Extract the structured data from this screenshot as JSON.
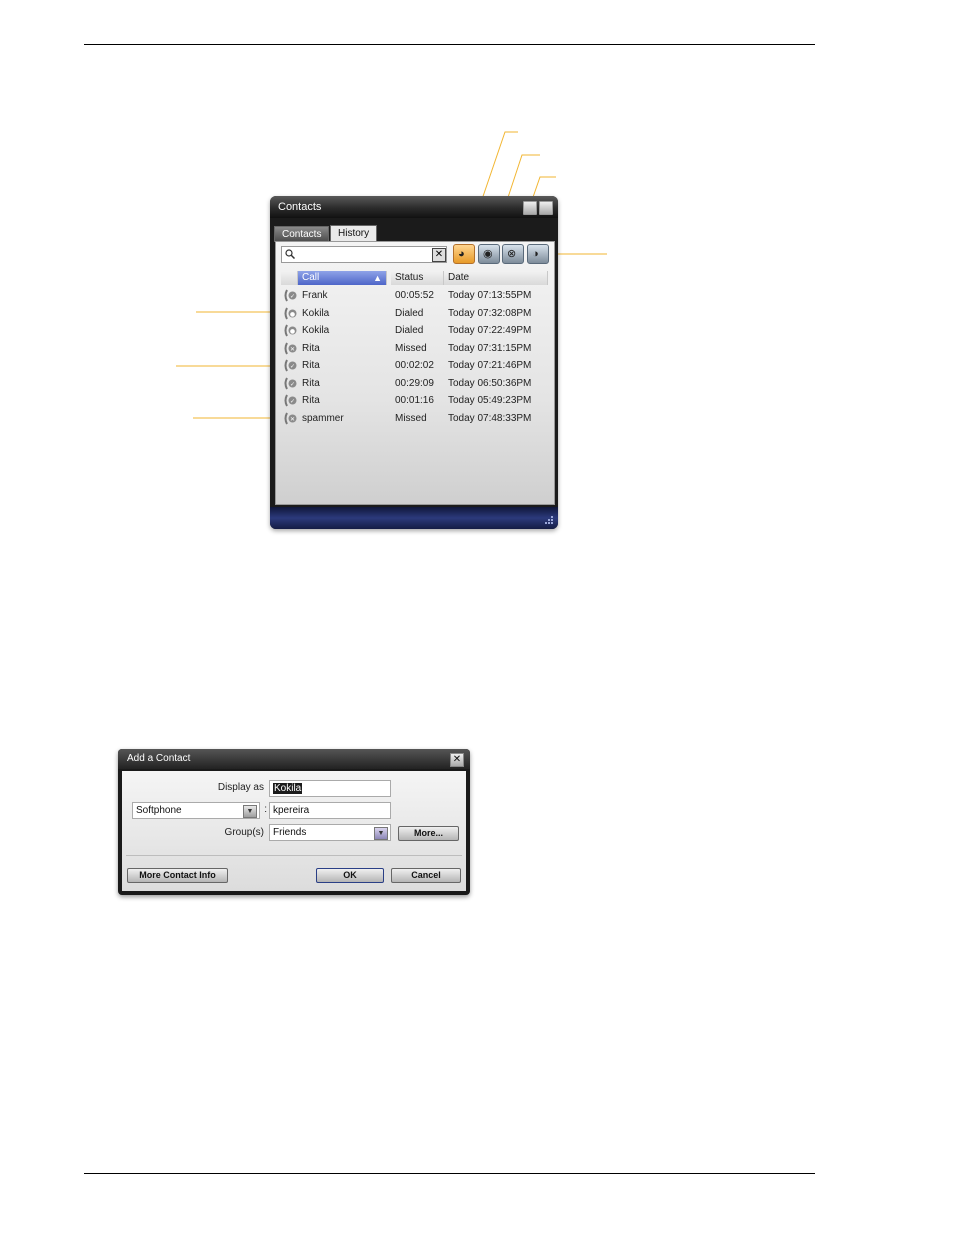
{
  "contacts_window": {
    "title": "Contacts",
    "tabs": [
      {
        "label": "Contacts",
        "active": false
      },
      {
        "label": "History",
        "active": true
      }
    ],
    "search": {
      "value": "",
      "placeholder": ""
    },
    "filter_buttons": [
      {
        "icon": "all-calls-icon",
        "active": true
      },
      {
        "icon": "dialed-calls-icon",
        "active": false
      },
      {
        "icon": "missed-calls-icon",
        "active": false
      },
      {
        "icon": "received-calls-icon",
        "active": false
      }
    ],
    "columns": {
      "call": "Call",
      "status": "Status",
      "date": "Date"
    },
    "rows": [
      {
        "icon": "received-call-icon",
        "call": "Frank",
        "status": "00:05:52",
        "date": "Today 07:13:55PM"
      },
      {
        "icon": "dialed-call-icon",
        "call": "Kokila",
        "status": "Dialed",
        "date": "Today 07:32:08PM"
      },
      {
        "icon": "dialed-call-icon",
        "call": "Kokila",
        "status": "Dialed",
        "date": "Today 07:22:49PM"
      },
      {
        "icon": "missed-call-icon",
        "call": "Rita",
        "status": "Missed",
        "date": "Today 07:31:15PM"
      },
      {
        "icon": "received-call-icon",
        "call": "Rita",
        "status": "00:02:02",
        "date": "Today 07:21:46PM"
      },
      {
        "icon": "received-call-icon",
        "call": "Rita",
        "status": "00:29:09",
        "date": "Today 06:50:36PM"
      },
      {
        "icon": "received-call-icon",
        "call": "Rita",
        "status": "00:01:16",
        "date": "Today 05:49:23PM"
      },
      {
        "icon": "missed-call-icon",
        "call": "spammer",
        "status": "Missed",
        "date": "Today 07:48:33PM"
      }
    ]
  },
  "add_contact_dialog": {
    "title": "Add a Contact",
    "display_as_label": "Display as",
    "display_as_value": "Kokila",
    "account_select": "Softphone",
    "address_value": "kpereira",
    "groups_label": "Group(s)",
    "groups_value": "Friends",
    "more_button": "More...",
    "more_contact_info_button": "More Contact Info",
    "ok_button": "OK",
    "cancel_button": "Cancel"
  },
  "colors": {
    "callout": "#f2b632",
    "selected_header": "#5a72d0",
    "active_filter": "#e79a28"
  }
}
